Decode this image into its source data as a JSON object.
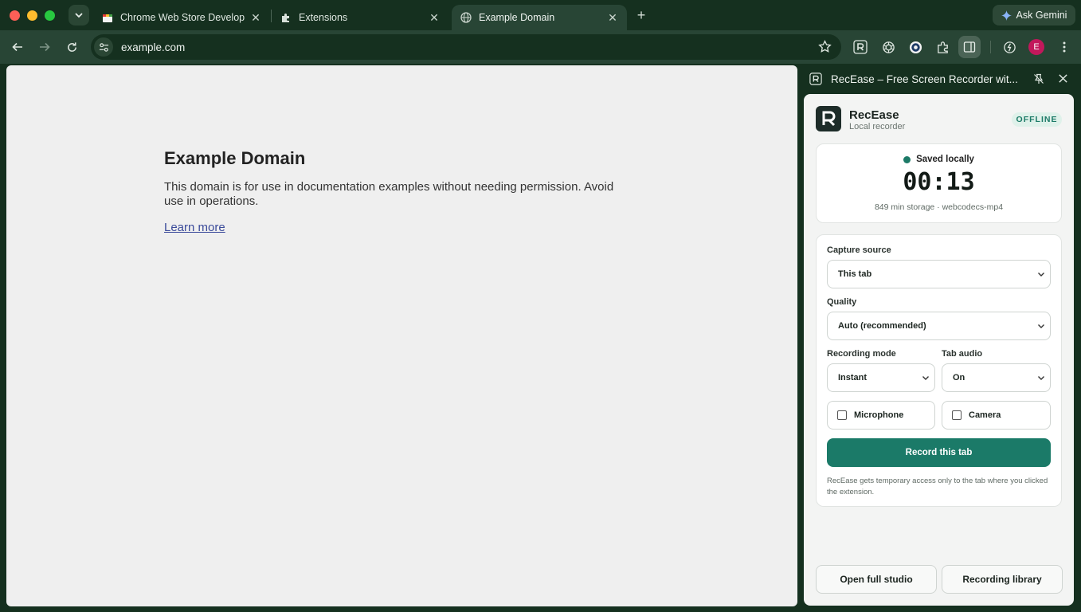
{
  "browser": {
    "tabs": [
      {
        "title": "Chrome Web Store Developer",
        "icon": "web-store-icon"
      },
      {
        "title": "Extensions",
        "icon": "puzzle-icon"
      },
      {
        "title": "Example Domain",
        "icon": "globe-icon",
        "active": true
      }
    ],
    "ask_gemini": "Ask Gemini",
    "url": "example.com",
    "avatar_letter": "E"
  },
  "page": {
    "heading": "Example Domain",
    "paragraph": "This domain is for use in documentation examples without needing permission. Avoid use in operations.",
    "link": "Learn more"
  },
  "side_panel": {
    "title": "RecEase – Free Screen Recorder wit...",
    "app_name": "RecEase",
    "app_subtitle": "Local recorder",
    "badge": "OFFLINE",
    "status_text": "Saved locally",
    "timer": "00:13",
    "storage_info": "849 min storage · webcodecs-mp4",
    "capture_source": {
      "label": "Capture source",
      "value": "This tab"
    },
    "quality": {
      "label": "Quality",
      "value": "Auto (recommended)"
    },
    "recording_mode": {
      "label": "Recording mode",
      "value": "Instant"
    },
    "tab_audio": {
      "label": "Tab audio",
      "value": "On"
    },
    "microphone": {
      "label": "Microphone",
      "checked": false
    },
    "camera": {
      "label": "Camera",
      "checked": false
    },
    "record_button": "Record this tab",
    "note": "RecEase gets temporary access only to the tab where you clicked the extension.",
    "open_studio": "Open full studio",
    "library": "Recording library"
  },
  "colors": {
    "frame": "#15301f",
    "toolbar": "#284535",
    "accent": "#1b7a68",
    "badge_bg": "#dff1ea"
  }
}
